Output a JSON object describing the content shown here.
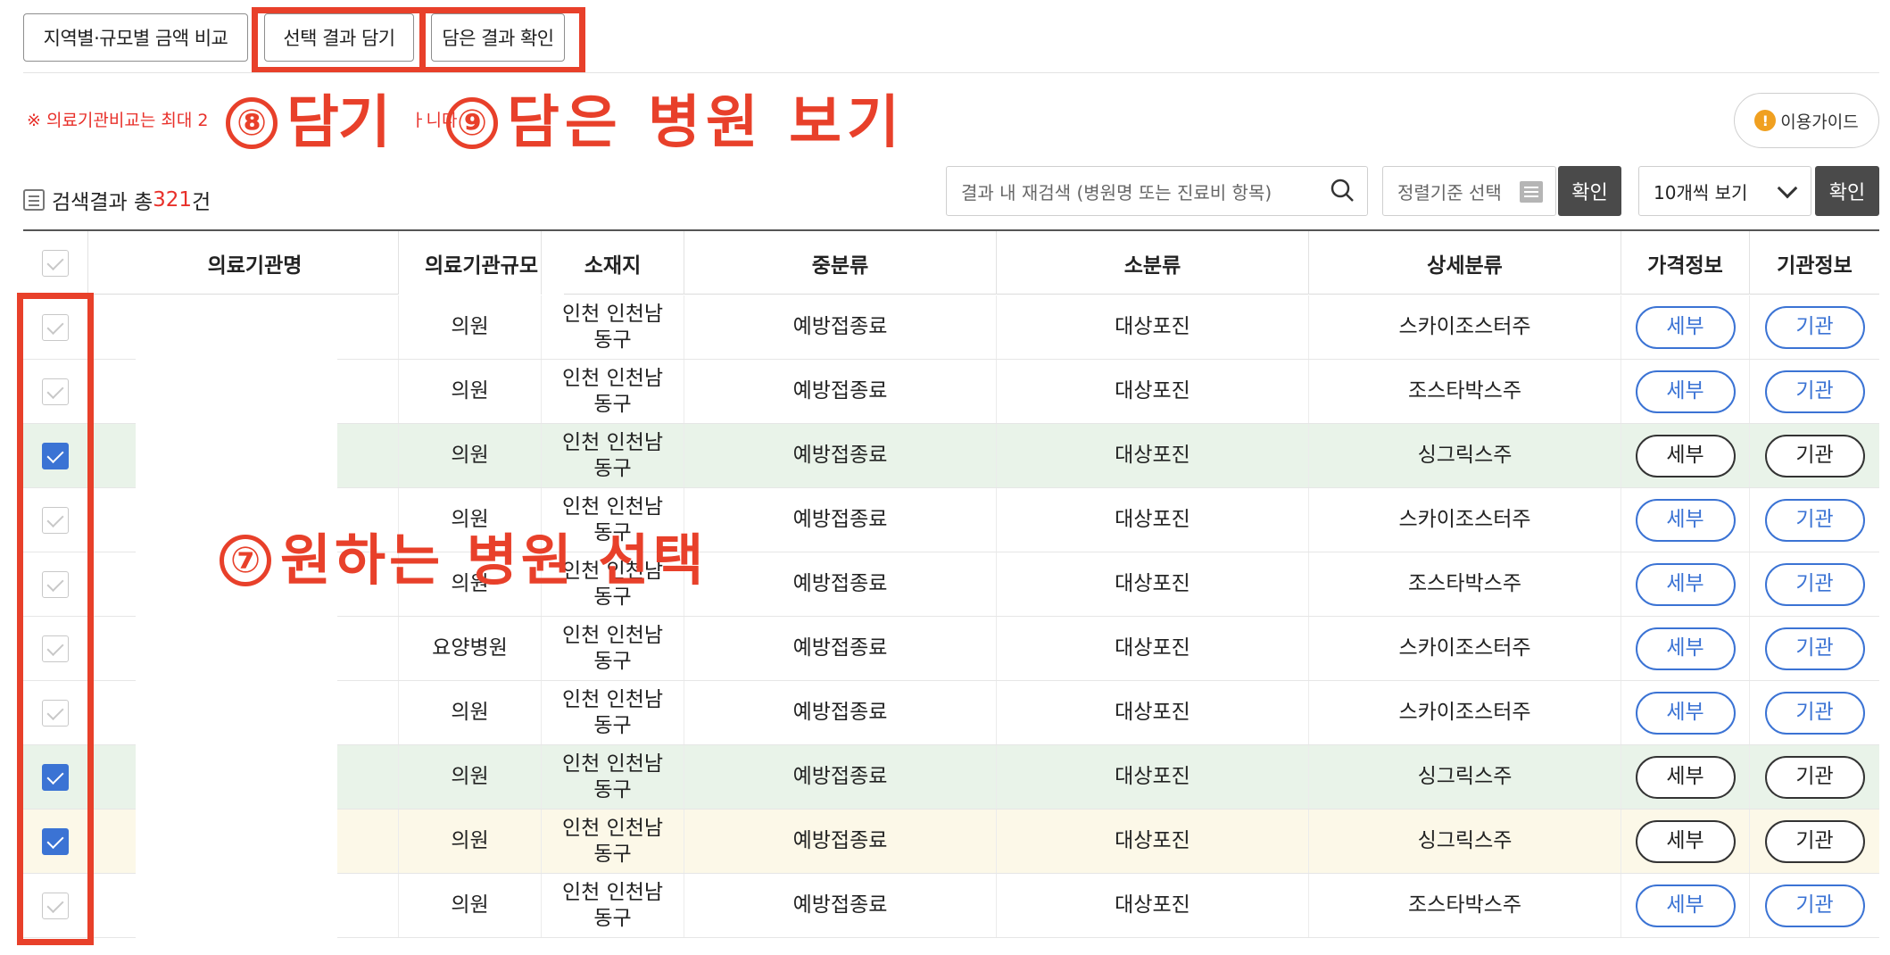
{
  "toolbar": {
    "compare_label": "지역별·규모별 금액 비교",
    "add_selected_label": "선택 결과 담기",
    "view_added_label": "담은 결과 확인"
  },
  "notice": "※ 의료기관비교는 최대 2",
  "notice_tail": "ㅏ니다",
  "annotations": {
    "step8_num": "⑧",
    "step8_text": "담기",
    "step9_num": "⑨",
    "step9_text": "담은 병원 보기",
    "step7_num": "⑦",
    "step7_text": "원하는 병원 선택"
  },
  "guide": {
    "label": "이용가이드",
    "icon": "warning-icon"
  },
  "result": {
    "prefix": "검색결과 총",
    "count": "321",
    "suffix": "건"
  },
  "search": {
    "placeholder": "결과 내 재검색 (병원명 또는 진료비 항목)"
  },
  "sort": {
    "placeholder": "정렬기준 선택"
  },
  "confirm_label": "확인",
  "view_select": {
    "value": "10개씩 보기"
  },
  "table": {
    "headers": [
      "의료기관명",
      "의료기관규모",
      "소재지",
      "중분류",
      "소분류",
      "상세분류",
      "가격정보",
      "기관정보"
    ],
    "detail_label": "세부",
    "org_label": "기관",
    "rows": [
      {
        "size": "의원",
        "loc1": "인천 인천남",
        "loc2": "동구",
        "mid": "예방접종료",
        "small": "대상포진",
        "detail": "스카이조스터주",
        "checked": false
      },
      {
        "size": "의원",
        "loc1": "인천 인천남",
        "loc2": "동구",
        "mid": "예방접종료",
        "small": "대상포진",
        "detail": "조스타박스주",
        "checked": false
      },
      {
        "size": "의원",
        "loc1": "인천 인천남",
        "loc2": "동구",
        "mid": "예방접종료",
        "small": "대상포진",
        "detail": "싱그릭스주",
        "checked": true
      },
      {
        "size": "의원",
        "loc1": "인천 인천남",
        "loc2": "동구",
        "mid": "예방접종료",
        "small": "대상포진",
        "detail": "스카이조스터주",
        "checked": false
      },
      {
        "size": "의원",
        "loc1": "인천 인천남",
        "loc2": "동구",
        "mid": "예방접종료",
        "small": "대상포진",
        "detail": "조스타박스주",
        "checked": false
      },
      {
        "size": "요양병원",
        "loc1": "인천 인천남",
        "loc2": "동구",
        "mid": "예방접종료",
        "small": "대상포진",
        "detail": "스카이조스터주",
        "checked": false
      },
      {
        "size": "의원",
        "loc1": "인천 인천남",
        "loc2": "동구",
        "mid": "예방접종료",
        "small": "대상포진",
        "detail": "스카이조스터주",
        "checked": false
      },
      {
        "size": "의원",
        "loc1": "인천 인천남",
        "loc2": "동구",
        "mid": "예방접종료",
        "small": "대상포진",
        "detail": "싱그릭스주",
        "checked": true
      },
      {
        "size": "의원",
        "loc1": "인천 인천남",
        "loc2": "동구",
        "mid": "예방접종료",
        "small": "대상포진",
        "detail": "싱그릭스주",
        "checked": true
      },
      {
        "size": "의원",
        "loc1": "인천 인천남",
        "loc2": "동구",
        "mid": "예방접종료",
        "small": "대상포진",
        "detail": "조스타박스주",
        "checked": false
      }
    ]
  },
  "colors": {
    "accent_red": "#e8402a",
    "link_blue": "#3b73d4",
    "selected_row": "#e9f3e9"
  }
}
